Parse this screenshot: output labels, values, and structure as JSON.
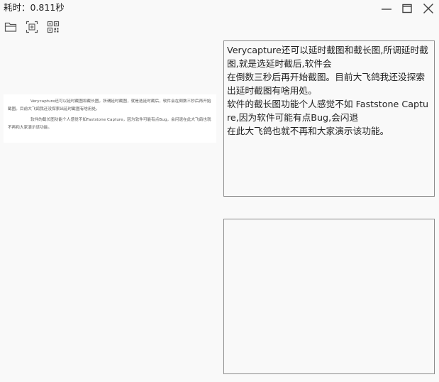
{
  "window": {
    "title": "耗时：0.811秒",
    "controls": {
      "minimize_icon": "minimize-icon",
      "maximize_icon": "maximize-icon",
      "close_icon": "close-icon"
    }
  },
  "toolbar": {
    "buttons": [
      {
        "icon": "folder-open-icon"
      },
      {
        "icon": "screen-capture-icon"
      },
      {
        "icon": "qr-code-icon"
      }
    ]
  },
  "preview": {
    "paragraphs": [
      "Verycapture还可以延时截图和截长图，所谓延时截图，就是选延时截后，软件会在倒数三秒后再开始截图。目前大飞鸽我还没探索出延时截图有啥用处。",
      "软件的截长图功能个人感觉不如Faststone Capture，因为软件可能有点Bug，会闪退在此大飞鸽也就不再和大家演示该功能。"
    ]
  },
  "result_panel": {
    "lines": [
      "Verycapture还可以延时截图和截长图,所调延时截图,就是选延时截后,软件会",
      "在倒数三秒后再开始截图。目前大飞鸽我还没探索出延时截图有啥用処。",
      "软件的截长图功能个人感觉不如 Faststone Capture,因为软件可能有点Bug,会闪退",
      "在此大飞鸽也就不再和大家演示该功能。"
    ]
  },
  "translation_panel": {
    "text": ""
  },
  "colors": {
    "background": "#f9f9f9",
    "border": "#8a8a8a",
    "icon": "#555555"
  }
}
